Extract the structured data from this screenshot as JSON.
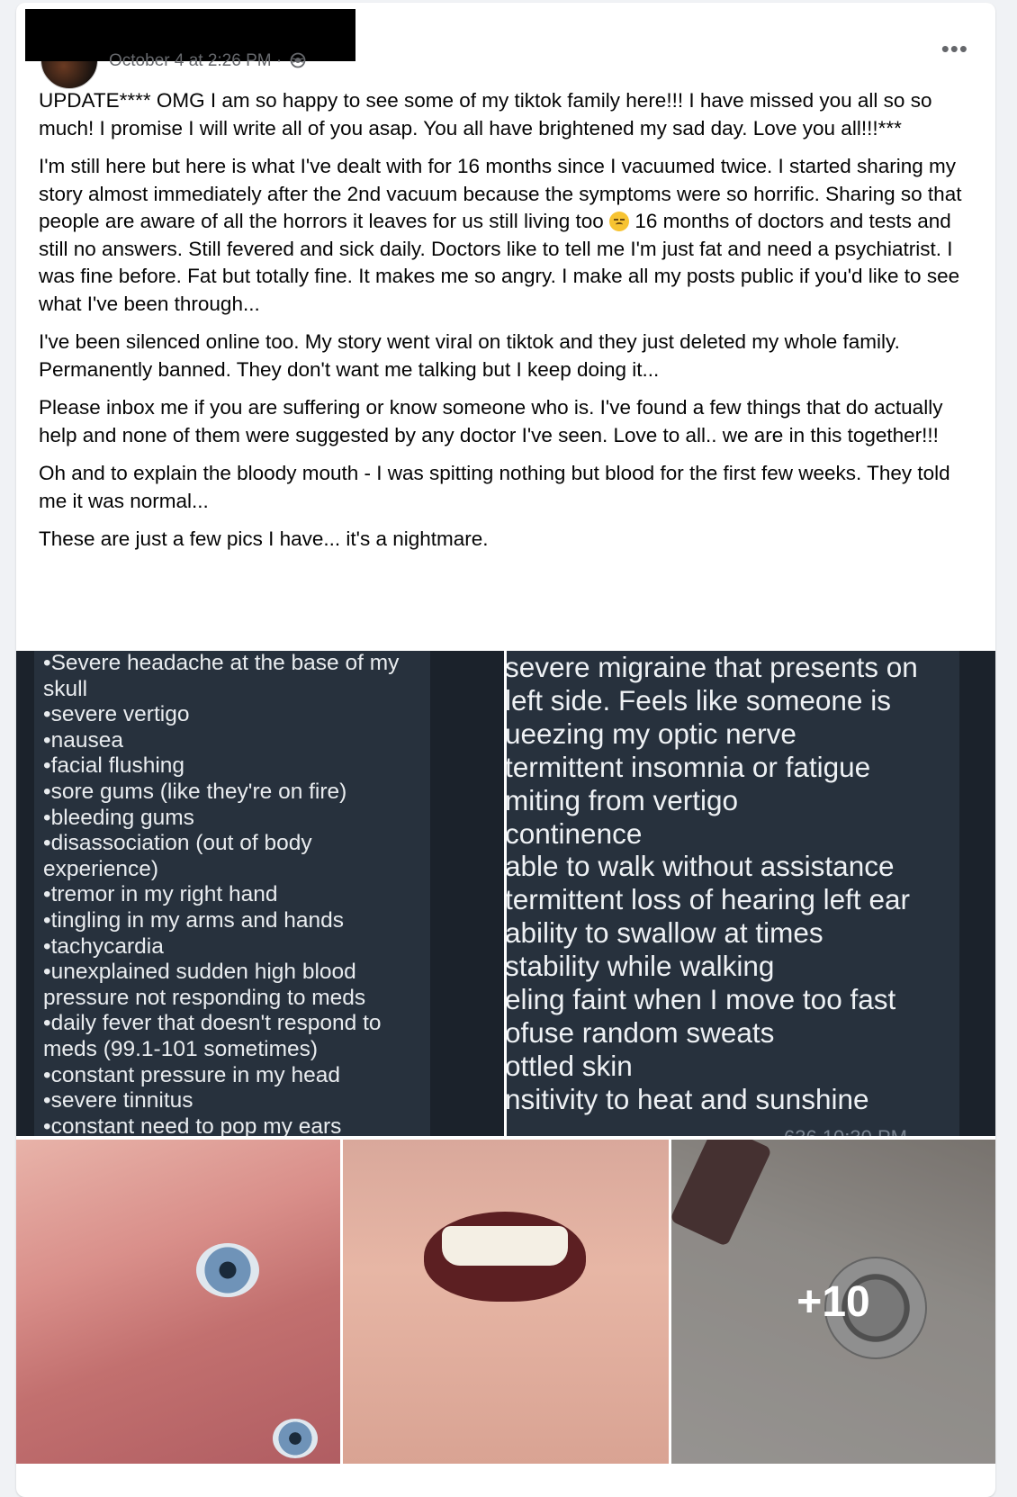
{
  "post": {
    "timestamp": "October 4 at 2:26 PM · ",
    "privacy_icon": "globe-icon",
    "more_label": "•••",
    "paragraphs": [
      "UPDATE**** OMG I am so happy to see some of my tiktok family here!!! I have missed you all so so much! I promise I will write all of you asap. You all have brightened my sad day. Love you all!!!***",
      "I'm still here but here is what I've dealt with for 16 months since I vacuumed twice. I started sharing my story almost immediately after the 2nd vacuum because the symptoms were so horrific. Sharing so that people are aware of all the horrors it leaves for us still living too",
      "16 months of doctors and tests and still no answers. Still fevered and sick daily. Doctors like to tell me I'm just fat and need a psychiatrist. I was fine before. Fat but totally fine. It makes me so angry. I make all my posts public if you'd like to see what I've been through...",
      "I've been silenced online too. My story went viral on tiktok and they just deleted my whole family. Permanently banned. They don't want me talking but I keep doing it...",
      "Please inbox me if you are suffering or know someone who is. I've found a few things that do actually help and none of them were suggested by any doctor I've seen. Love to all..  we are in this together!!!",
      "Oh and to explain the bloody mouth - I was spitting nothing but blood for the first few weeks. They told me it was normal...",
      "These are just a few pics I have... it's a nightmare."
    ],
    "emoji_name": "pensive-face-icon"
  },
  "photos": {
    "list1": [
      "•Severe headache at the base of my skull",
      "•severe vertigo",
      "•nausea",
      "•facial flushing",
      "•sore gums (like they're on fire)",
      "•bleeding gums",
      "•disassociation (out of body experience)",
      "•tremor in my right hand",
      "•tingling in my arms and hands",
      "•tachycardia",
      "•unexplained sudden high blood pressure not responding to meds",
      "•daily fever that doesn't respond to meds (99.1-101 sometimes)",
      "•constant pressure in my head",
      "•severe tinnitus",
      "•constant need to pop my ears"
    ],
    "list2": [
      "severe migraine that presents on",
      " left side. Feels like someone is",
      "ueezing my optic nerve",
      "termittent insomnia or fatigue",
      "miting from vertigo",
      "continence",
      "able to walk without assistance",
      "termittent loss of hearing left ear",
      "ability to swallow at times",
      "stability while walking",
      "eling faint when I move too fast",
      "ofuse random sweats",
      "ottled skin",
      "nsitivity to heat and sunshine"
    ],
    "list2_footer": "636  10:30 PM",
    "more_count": "+10"
  },
  "colors": {
    "card_bg": "#ffffff",
    "page_bg": "#f0f2f5",
    "text": "#050505",
    "meta_text": "#65676b",
    "dark_panel": "#27313d"
  }
}
